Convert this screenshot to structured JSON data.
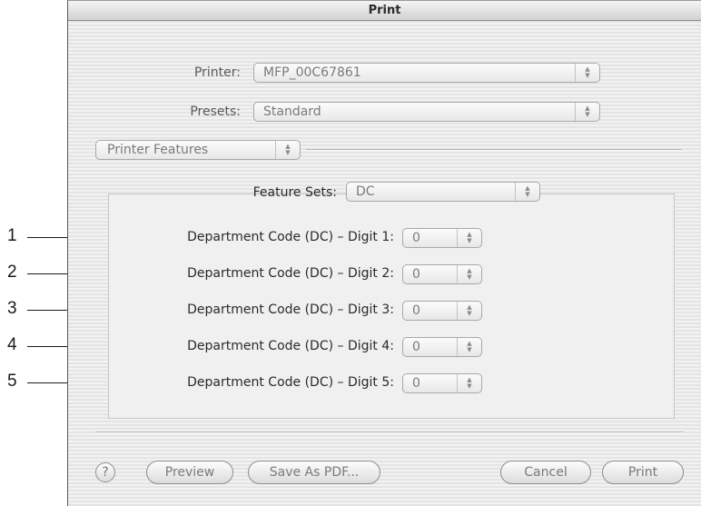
{
  "window": {
    "title": "Print"
  },
  "printer": {
    "label": "Printer:",
    "value": "MFP_00C67861"
  },
  "presets": {
    "label": "Presets:",
    "value": "Standard"
  },
  "pane_menu": {
    "value": "Printer Features"
  },
  "feature_sets": {
    "label": "Feature Sets:",
    "value": "DC"
  },
  "digits": [
    {
      "callout": "1",
      "label": "Department Code (DC) – Digit 1:",
      "value": "0"
    },
    {
      "callout": "2",
      "label": "Department Code (DC) – Digit 2:",
      "value": "0"
    },
    {
      "callout": "3",
      "label": "Department Code (DC) – Digit 3:",
      "value": "0"
    },
    {
      "callout": "4",
      "label": "Department Code (DC) – Digit 4:",
      "value": "0"
    },
    {
      "callout": "5",
      "label": "Department Code (DC) – Digit 5:",
      "value": "0"
    }
  ],
  "buttons": {
    "help": "?",
    "preview": "Preview",
    "save_as_pdf": "Save As PDF...",
    "cancel": "Cancel",
    "print": "Print"
  },
  "icons": {
    "popup_arrows": "updown-arrows-icon",
    "help": "help-icon"
  }
}
